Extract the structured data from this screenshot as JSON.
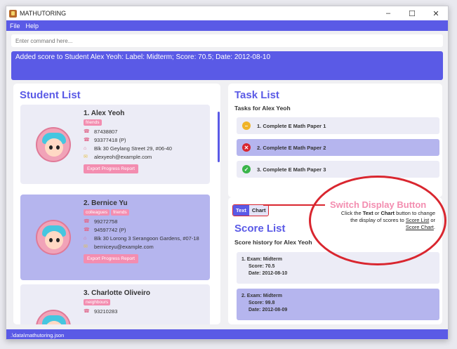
{
  "window": {
    "title": "MATHUTORING",
    "controls": [
      "–",
      "☐",
      "✕"
    ]
  },
  "menu": [
    "File",
    "Help"
  ],
  "command": {
    "placeholder": "Enter command here..."
  },
  "result": "Added score to Student Alex Yeoh: Label: Midterm; Score: 70.5; Date: 2012-08-10",
  "student_list": {
    "title": "Student List",
    "students": [
      {
        "name": "1.  Alex Yeoh",
        "tags": [
          "friends"
        ],
        "phones": [
          "87438807",
          "93377418 (P)"
        ],
        "address": "Blk 30 Geylang Street 29, #06-40",
        "email": "alexyeoh@example.com",
        "button": "Export Progress Report"
      },
      {
        "name": "2.  Bernice Yu",
        "tags": [
          "colleagues",
          "friends"
        ],
        "phones": [
          "99272758",
          "94597742 (P)"
        ],
        "address": "Blk 30 Lorong 3 Serangoon Gardens, #07-18",
        "email": "berniceyu@example.com",
        "button": "Export Progress Report"
      },
      {
        "name": "3.  Charlotte Oliveiro",
        "tags": [
          "neighbours"
        ],
        "phones": [
          "93210283"
        ]
      }
    ]
  },
  "task_list": {
    "title": "Task List",
    "subtitle": "Tasks for Alex Yeoh",
    "tasks": [
      {
        "label": "1. Complete E Math Paper 1",
        "status_icon": "minus-icon",
        "color": "#f0b429"
      },
      {
        "label": "2. Complete E Math Paper 2",
        "status_icon": "cross-icon",
        "color": "#d9262f"
      },
      {
        "label": "3. Complete E Math Paper 3",
        "status_icon": "check-icon",
        "color": "#3ab54a"
      }
    ]
  },
  "score_panel": {
    "tabs": [
      "Text",
      "Chart"
    ],
    "title": "Score List",
    "subtitle": "Score history for Alex Yeoh",
    "scores": [
      {
        "exam": "1. Exam: Midterm",
        "score": "Score: 70.5",
        "date": "Date: 2012-08-10"
      },
      {
        "exam": "2. Exam: Midterm",
        "score": "Score: 99.8",
        "date": "Date: 2012-08-09"
      }
    ]
  },
  "annotation": {
    "title": "Switch Display Button",
    "desc_1": "Click the ",
    "desc_text": "Text",
    "desc_2": " or ",
    "desc_chart": "Chart",
    "desc_3": " button to change the display of scores to ",
    "desc_link1": "Score List",
    "desc_4": " or ",
    "desc_link2": "Score Chart",
    "desc_5": "."
  },
  "status_bar": ".\\data\\mathutoring.json",
  "colors": {
    "accent": "#5a5ae6",
    "tag": "#f38db0",
    "annotation": "#d9262f"
  }
}
